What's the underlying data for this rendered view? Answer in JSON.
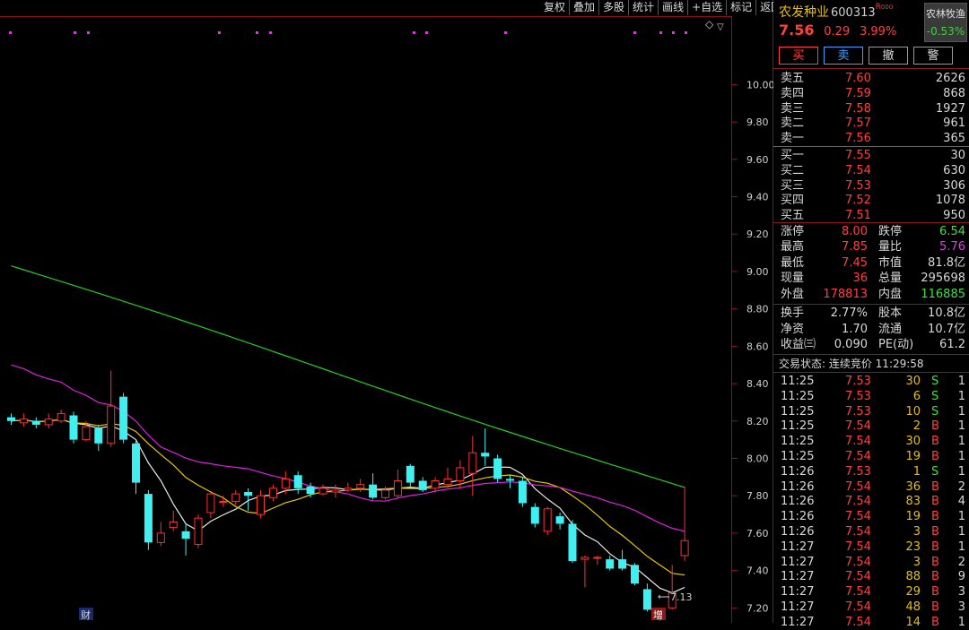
{
  "toolbar": {
    "items": [
      "复权",
      "叠加",
      "多股",
      "统计",
      "画线",
      "+自选",
      "标记",
      "返回"
    ]
  },
  "stock": {
    "name": "农发种业",
    "code": "600313",
    "tag": "R",
    "tag_suffix": "000",
    "price": "7.56",
    "change": "0.29",
    "pct": "3.99%"
  },
  "sector": {
    "name": "农林牧渔",
    "change": "-0.53%"
  },
  "trade_buttons": [
    "买",
    "卖",
    "撤",
    "警"
  ],
  "asks": [
    {
      "label": "卖五",
      "price": "7.60",
      "vol": "2626"
    },
    {
      "label": "卖四",
      "price": "7.59",
      "vol": "868"
    },
    {
      "label": "卖三",
      "price": "7.58",
      "vol": "1927"
    },
    {
      "label": "卖二",
      "price": "7.57",
      "vol": "961"
    },
    {
      "label": "卖一",
      "price": "7.56",
      "vol": "365"
    }
  ],
  "bids": [
    {
      "label": "买一",
      "price": "7.55",
      "vol": "30"
    },
    {
      "label": "买二",
      "price": "7.54",
      "vol": "630"
    },
    {
      "label": "买三",
      "price": "7.53",
      "vol": "306"
    },
    {
      "label": "买四",
      "price": "7.52",
      "vol": "1078"
    },
    {
      "label": "买五",
      "price": "7.51",
      "vol": "950"
    }
  ],
  "stats": [
    {
      "l1": "涨停",
      "v1": "8.00",
      "c1": "red",
      "l2": "跌停",
      "v2": "6.54",
      "c2": "green"
    },
    {
      "l1": "最高",
      "v1": "7.85",
      "c1": "red",
      "l2": "量比",
      "v2": "5.76",
      "c2": "mag"
    },
    {
      "l1": "最低",
      "v1": "7.45",
      "c1": "red",
      "l2": "市值",
      "v2": "81.8亿",
      "c2": "white"
    },
    {
      "l1": "现量",
      "v1": "36",
      "c1": "red",
      "l2": "总量",
      "v2": "295698",
      "c2": "white"
    },
    {
      "l1": "外盘",
      "v1": "178813",
      "c1": "red",
      "l2": "内盘",
      "v2": "116885",
      "c2": "green"
    }
  ],
  "stats2": [
    {
      "l1": "换手",
      "v1": "2.77%",
      "l2": "股本",
      "v2": "10.8亿"
    },
    {
      "l1": "净资",
      "v1": "1.70",
      "l2": "流通",
      "v2": "10.7亿"
    },
    {
      "l1": "收益㈢",
      "v1": "0.090",
      "l2": "PE(动)",
      "v2": "61.2"
    }
  ],
  "trade_status": "交易状态: 连续竞价 11:29:58",
  "ticks": [
    {
      "t": "11:25",
      "p": "7.53",
      "v": "30",
      "s": "S",
      "n": "1"
    },
    {
      "t": "11:25",
      "p": "7.53",
      "v": "6",
      "s": "S",
      "n": "1"
    },
    {
      "t": "11:25",
      "p": "7.53",
      "v": "10",
      "s": "S",
      "n": "1"
    },
    {
      "t": "11:25",
      "p": "7.54",
      "v": "2",
      "s": "B",
      "n": "1"
    },
    {
      "t": "11:25",
      "p": "7.54",
      "v": "30",
      "s": "B",
      "n": "1"
    },
    {
      "t": "11:25",
      "p": "7.54",
      "v": "19",
      "s": "B",
      "n": "1"
    },
    {
      "t": "11:26",
      "p": "7.53",
      "v": "1",
      "s": "S",
      "n": "1"
    },
    {
      "t": "11:26",
      "p": "7.54",
      "v": "36",
      "s": "B",
      "n": "2"
    },
    {
      "t": "11:26",
      "p": "7.54",
      "v": "83",
      "s": "B",
      "n": "4"
    },
    {
      "t": "11:26",
      "p": "7.54",
      "v": "19",
      "s": "B",
      "n": "1"
    },
    {
      "t": "11:26",
      "p": "7.54",
      "v": "3",
      "s": "B",
      "n": "1"
    },
    {
      "t": "11:27",
      "p": "7.54",
      "v": "23",
      "s": "B",
      "n": "1"
    },
    {
      "t": "11:27",
      "p": "7.54",
      "v": "3",
      "s": "B",
      "n": "2"
    },
    {
      "t": "11:27",
      "p": "7.54",
      "v": "88",
      "s": "B",
      "n": "9"
    },
    {
      "t": "11:27",
      "p": "7.54",
      "v": "29",
      "s": "B",
      "n": "3"
    },
    {
      "t": "11:27",
      "p": "7.54",
      "v": "48",
      "s": "B",
      "n": "3"
    },
    {
      "t": "11:27",
      "p": "7.54",
      "v": "14",
      "s": "B",
      "n": "1"
    }
  ],
  "chart_data": {
    "type": "candlestick",
    "yticks": [
      "10.00",
      "9.80",
      "9.60",
      "9.40",
      "9.20",
      "9.00",
      "8.80",
      "8.60",
      "8.40",
      "8.20",
      "8.00",
      "7.80",
      "7.60",
      "7.40",
      "7.20"
    ],
    "ylim": [
      7.12,
      10.28
    ],
    "low_marker": "7.13",
    "markers": [
      "财",
      "增"
    ],
    "candles": [
      {
        "o": 8.22,
        "c": 8.2,
        "h": 8.24,
        "l": 8.18
      },
      {
        "o": 8.19,
        "c": 8.21,
        "h": 8.24,
        "l": 8.17
      },
      {
        "o": 8.2,
        "c": 8.18,
        "h": 8.22,
        "l": 8.16
      },
      {
        "o": 8.18,
        "c": 8.21,
        "h": 8.24,
        "l": 8.16
      },
      {
        "o": 8.2,
        "c": 8.24,
        "h": 8.26,
        "l": 8.19
      },
      {
        "o": 8.23,
        "c": 8.1,
        "h": 8.25,
        "l": 8.08
      },
      {
        "o": 8.1,
        "c": 8.17,
        "h": 8.2,
        "l": 8.09
      },
      {
        "o": 8.16,
        "c": 8.08,
        "h": 8.18,
        "l": 8.04
      },
      {
        "o": 8.08,
        "c": 8.28,
        "h": 8.47,
        "l": 8.06
      },
      {
        "o": 8.33,
        "c": 8.1,
        "h": 8.35,
        "l": 8.08
      },
      {
        "o": 8.08,
        "c": 7.87,
        "h": 8.1,
        "l": 7.81
      },
      {
        "o": 7.81,
        "c": 7.55,
        "h": 7.83,
        "l": 7.51
      },
      {
        "o": 7.55,
        "c": 7.6,
        "h": 7.66,
        "l": 7.53
      },
      {
        "o": 7.63,
        "c": 7.66,
        "h": 7.72,
        "l": 7.61
      },
      {
        "o": 7.61,
        "c": 7.57,
        "h": 7.65,
        "l": 7.48
      },
      {
        "o": 7.54,
        "c": 7.68,
        "h": 7.7,
        "l": 7.52
      },
      {
        "o": 7.71,
        "c": 7.81,
        "h": 7.82,
        "l": 7.68
      },
      {
        "o": 7.77,
        "c": 7.77,
        "h": 7.8,
        "l": 7.74
      },
      {
        "o": 7.77,
        "c": 7.81,
        "h": 7.83,
        "l": 7.75
      },
      {
        "o": 7.82,
        "c": 7.8,
        "h": 7.84,
        "l": 7.72
      },
      {
        "o": 7.7,
        "c": 7.8,
        "h": 7.83,
        "l": 7.68
      },
      {
        "o": 7.79,
        "c": 7.84,
        "h": 7.86,
        "l": 7.77
      },
      {
        "o": 7.84,
        "c": 7.89,
        "h": 7.93,
        "l": 7.81
      },
      {
        "o": 7.91,
        "c": 7.84,
        "h": 7.93,
        "l": 7.81
      },
      {
        "o": 7.85,
        "c": 7.81,
        "h": 7.87,
        "l": 7.79
      },
      {
        "o": 7.81,
        "c": 7.84,
        "h": 7.86,
        "l": 7.8
      },
      {
        "o": 7.82,
        "c": 7.83,
        "h": 7.86,
        "l": 7.79
      },
      {
        "o": 7.83,
        "c": 7.84,
        "h": 7.87,
        "l": 7.82
      },
      {
        "o": 7.84,
        "c": 7.86,
        "h": 7.89,
        "l": 7.82
      },
      {
        "o": 7.86,
        "c": 7.79,
        "h": 7.92,
        "l": 7.78
      },
      {
        "o": 7.79,
        "c": 7.83,
        "h": 7.85,
        "l": 7.78
      },
      {
        "o": 7.8,
        "c": 7.88,
        "h": 7.94,
        "l": 7.79
      },
      {
        "o": 7.96,
        "c": 7.87,
        "h": 7.97,
        "l": 7.85
      },
      {
        "o": 7.88,
        "c": 7.83,
        "h": 7.9,
        "l": 7.82
      },
      {
        "o": 7.84,
        "c": 7.88,
        "h": 7.9,
        "l": 7.82
      },
      {
        "o": 7.86,
        "c": 7.89,
        "h": 7.95,
        "l": 7.84
      },
      {
        "o": 7.88,
        "c": 7.95,
        "h": 7.99,
        "l": 7.84
      },
      {
        "o": 7.92,
        "c": 8.03,
        "h": 8.12,
        "l": 7.8
      },
      {
        "o": 8.03,
        "c": 8.01,
        "h": 8.16,
        "l": 7.96
      },
      {
        "o": 8.0,
        "c": 7.89,
        "h": 8.02,
        "l": 7.87
      },
      {
        "o": 7.89,
        "c": 7.88,
        "h": 7.91,
        "l": 7.84
      },
      {
        "o": 7.88,
        "c": 7.76,
        "h": 7.9,
        "l": 7.74
      },
      {
        "o": 7.74,
        "c": 7.65,
        "h": 7.76,
        "l": 7.63
      },
      {
        "o": 7.61,
        "c": 7.73,
        "h": 7.74,
        "l": 7.59
      },
      {
        "o": 7.69,
        "c": 7.65,
        "h": 7.71,
        "l": 7.62
      },
      {
        "o": 7.65,
        "c": 7.45,
        "h": 7.67,
        "l": 7.44
      },
      {
        "o": 7.46,
        "c": 7.47,
        "h": 7.48,
        "l": 7.31
      },
      {
        "o": 7.47,
        "c": 7.47,
        "h": 7.48,
        "l": 7.43
      },
      {
        "o": 7.46,
        "c": 7.41,
        "h": 7.48,
        "l": 7.4
      },
      {
        "o": 7.46,
        "c": 7.41,
        "h": 7.51,
        "l": 7.4
      },
      {
        "o": 7.43,
        "c": 7.33,
        "h": 7.44,
        "l": 7.32
      },
      {
        "o": 7.3,
        "c": 7.19,
        "h": 7.33,
        "l": 7.18
      },
      {
        "o": 7.18,
        "c": 7.19,
        "h": 7.2,
        "l": 7.13
      },
      {
        "o": 7.2,
        "c": 7.28,
        "h": 7.43,
        "l": 7.19
      },
      {
        "o": 7.48,
        "c": 7.56,
        "h": 7.85,
        "l": 7.45
      }
    ]
  },
  "colors": {
    "up": "#ff3030",
    "down": "#40f0f0",
    "ma5": "#e8e8e8",
    "ma10": "#e8c800",
    "ma20": "#e020e0",
    "ma60": "#20d020",
    "axis": "#a01010"
  }
}
